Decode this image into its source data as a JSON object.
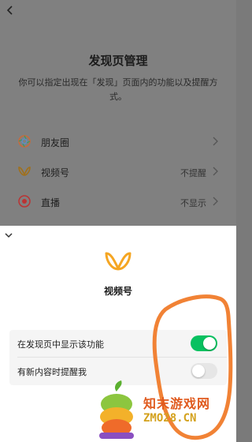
{
  "background": {
    "title": "发现页管理",
    "description": "你可以指定出现在「发现」页面内的功能以及提醒方式。",
    "items": [
      {
        "label": "朋友圈",
        "value": "",
        "icon": "moments-icon"
      },
      {
        "label": "视频号",
        "value": "不提醒",
        "icon": "channels-icon"
      },
      {
        "label": "直播",
        "value": "不显示",
        "icon": "live-icon"
      }
    ]
  },
  "sheet": {
    "title": "视频号",
    "icon": "channels-icon",
    "settings": [
      {
        "label": "在发现页中显示该功能",
        "enabled": true
      },
      {
        "label": "有新内容时提醒我",
        "enabled": false
      }
    ]
  },
  "watermark": {
    "text": "知末游戏网",
    "url": "ZMO28.CN"
  },
  "colors": {
    "accent": "#07c160",
    "channels": "#f5a623",
    "scribble": "#f07b2a"
  }
}
